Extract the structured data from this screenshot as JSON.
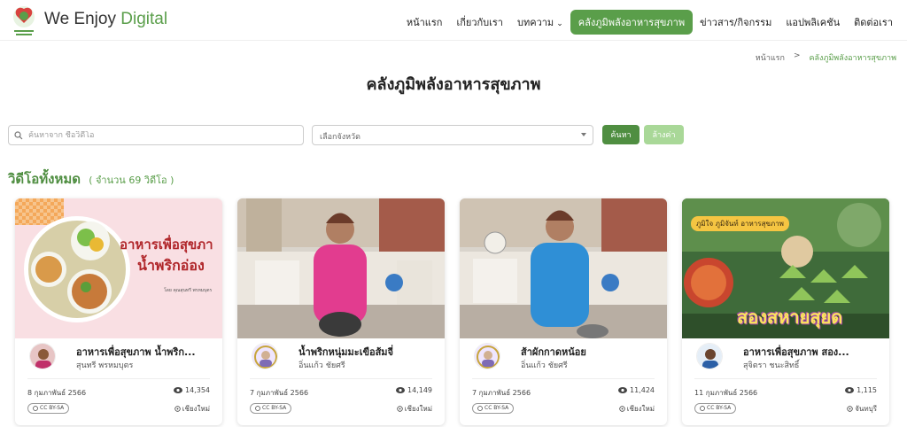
{
  "brand": {
    "prefix": "We Enjoy",
    "suffix": "Digital"
  },
  "nav": {
    "items": [
      {
        "label": "หน้าแรก"
      },
      {
        "label": "เกี่ยวกับเรา"
      },
      {
        "label": "บทความ"
      },
      {
        "label": "คลังภูมิพลังอาหารสุขภาพ"
      },
      {
        "label": "ข่าวสาร/กิจกรรม"
      },
      {
        "label": "แอปพลิเคชัน"
      },
      {
        "label": "ติดต่อเรา"
      }
    ]
  },
  "breadcrumb": {
    "home": "หน้าแรก",
    "separator": ">",
    "current": "คลังภูมิพลังอาหารสุขภาพ"
  },
  "page_title": "คลังภูมิพลังอาหารสุขภาพ",
  "search": {
    "placeholder": "ค้นหาจาก ชื่อวิดีโอ",
    "value": ""
  },
  "province_select": {
    "selected": "เลือกจังหวัด"
  },
  "buttons": {
    "search": "ค้นหา",
    "clear": "ล้างค่า"
  },
  "section": {
    "title": "วิดีโอทั้งหมด",
    "count": "( จำนวน 69 วิดีโอ )"
  },
  "cards": [
    {
      "title": "อาหารเพื่อสุขภาพ น้ำพริก...",
      "author": "สุนทรี พรหมบุตร",
      "date": "8 กุมภาพันธ์ 2566",
      "views": "14,354",
      "license": "CC BY-SA",
      "location": "เชียงใหม่",
      "thumb_text_1": "อาหารเพื่อสุขภา",
      "thumb_text_2": "น้ำพริกอ่อง",
      "thumb_caption": "โดย คุณสุนทรี พรหมบุตร"
    },
    {
      "title": "น้ำพริกหนุ่มมะเขือส้มจี่",
      "author": "อิ่นแก้ว ชัยศรี",
      "date": "7 กุมภาพันธ์ 2566",
      "views": "14,149",
      "license": "CC BY-SA",
      "location": "เชียงใหม่"
    },
    {
      "title": "ส้าผักกาดหน้อย",
      "author": "อิ่นแก้ว ชัยศรี",
      "date": "7 กุมภาพันธ์ 2566",
      "views": "11,424",
      "license": "CC BY-SA",
      "location": "เชียงใหม่"
    },
    {
      "title": "อาหารเพื่อสุขภาพ สอง...",
      "author": "สุจิตรา ชนะสิทธิ์",
      "date": "11 กุมภาพันธ์ 2566",
      "views": "1,115",
      "license": "CC BY-SA",
      "location": "จันทบุรี",
      "thumb_text_1": "ภูมิใจ ภูมิจันท์ อาหารสุขภาพ",
      "thumb_text_2": "สองสหายสุยด"
    }
  ],
  "colors": {
    "accent": "#5a9e4a",
    "accent_dark": "#4f8e41",
    "accent_light": "#a9d898"
  }
}
